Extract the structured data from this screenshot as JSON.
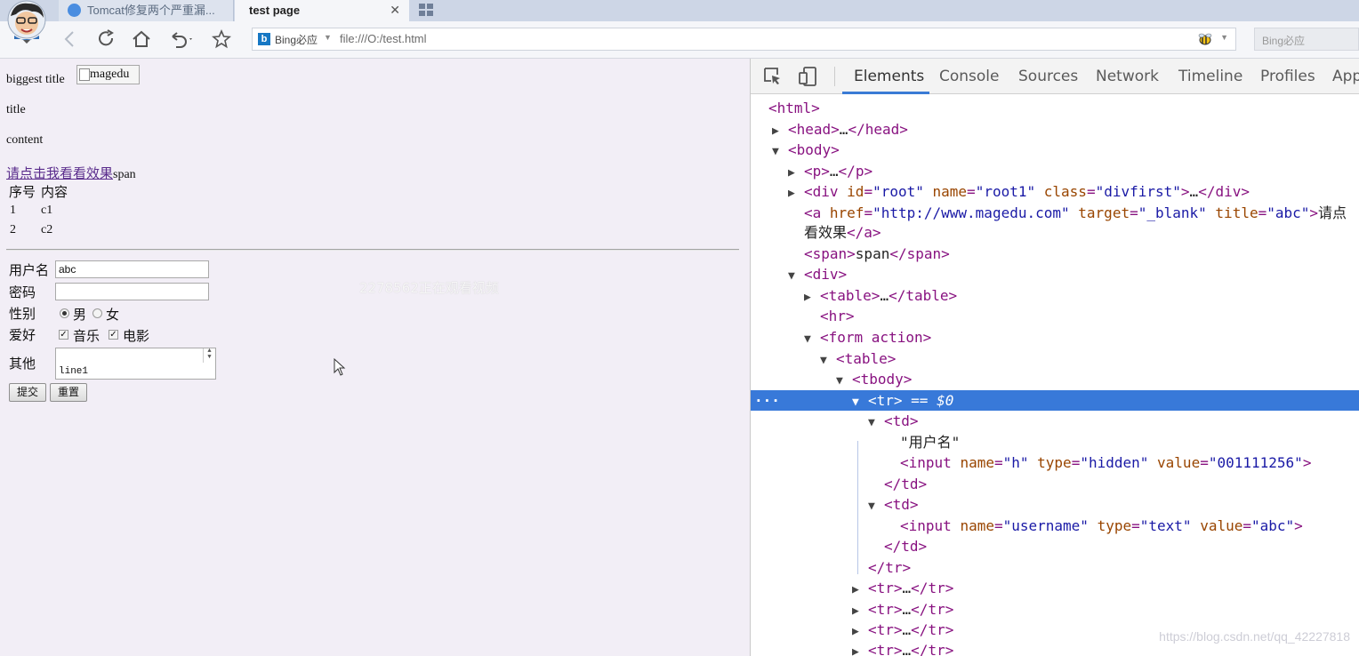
{
  "browser": {
    "tabs": [
      {
        "label": "Tomcat修复两个严重漏..."
      },
      {
        "label": "test page"
      }
    ],
    "search_engine": "Bing必应",
    "url": "file:///O:/test.html",
    "search_placeholder": "Bing必应"
  },
  "page": {
    "h1": "biggest title",
    "img_alt": "magedu",
    "h2": "title",
    "p": "content",
    "link": "请点击我看看效果",
    "span": "span",
    "table": {
      "headers": [
        "序号",
        "内容"
      ],
      "rows": [
        [
          "1",
          "c1"
        ],
        [
          "2",
          "c2"
        ]
      ]
    },
    "form": {
      "username_label": "用户名",
      "username_value": "abc",
      "password_label": "密码",
      "gender_label": "性别",
      "gender_options": [
        "男",
        "女"
      ],
      "hobby_label": "爱好",
      "hobby_options": [
        "音乐",
        "电影"
      ],
      "other_label": "其他",
      "other_value": "line1",
      "submit": "提交",
      "reset": "重置"
    },
    "watermark": "2278562正在观看视频"
  },
  "devtools": {
    "tabs": [
      "Elements",
      "Console",
      "Sources",
      "Network",
      "Timeline",
      "Profiles",
      "App"
    ],
    "active_tab": "Elements",
    "dom": [
      {
        "t": "<html>"
      },
      {
        "t": "<head>…</head>"
      },
      {
        "t": "<body>"
      },
      {
        "t": "<p>…</p>"
      },
      {
        "t": "<div id=\"root\" name=\"root1\" class=\"divfirst\">…</div>"
      },
      {
        "t": "<a href=\"http://www.magedu.com\" target=\"_blank\" title=\"abc\">请点"
      },
      {
        "t": "看效果</a>"
      },
      {
        "t": "<span>span</span>"
      },
      {
        "t": "<div>"
      },
      {
        "t": "<table>…</table>"
      },
      {
        "t": "<hr>"
      },
      {
        "t": "<form action>"
      },
      {
        "t": "<table>"
      },
      {
        "t": "<tbody>"
      },
      {
        "t": "<tr> == $0"
      },
      {
        "t": "<td>"
      },
      {
        "t": "\"用户名\""
      },
      {
        "t": "<input name=\"h\" type=\"hidden\" value=\"001111256\">"
      },
      {
        "t": "</td>"
      },
      {
        "t": "<td>"
      },
      {
        "t": "<input name=\"username\" type=\"text\" value=\"abc\">"
      },
      {
        "t": "</td>"
      },
      {
        "t": "</tr>"
      },
      {
        "t": "<tr>…</tr>"
      },
      {
        "t": "<tr>…</tr>"
      },
      {
        "t": "<tr>…</tr>"
      },
      {
        "t": "<tr>…</tr>"
      }
    ]
  },
  "csdn_watermark": "https://blog.csdn.net/qq_42227818"
}
